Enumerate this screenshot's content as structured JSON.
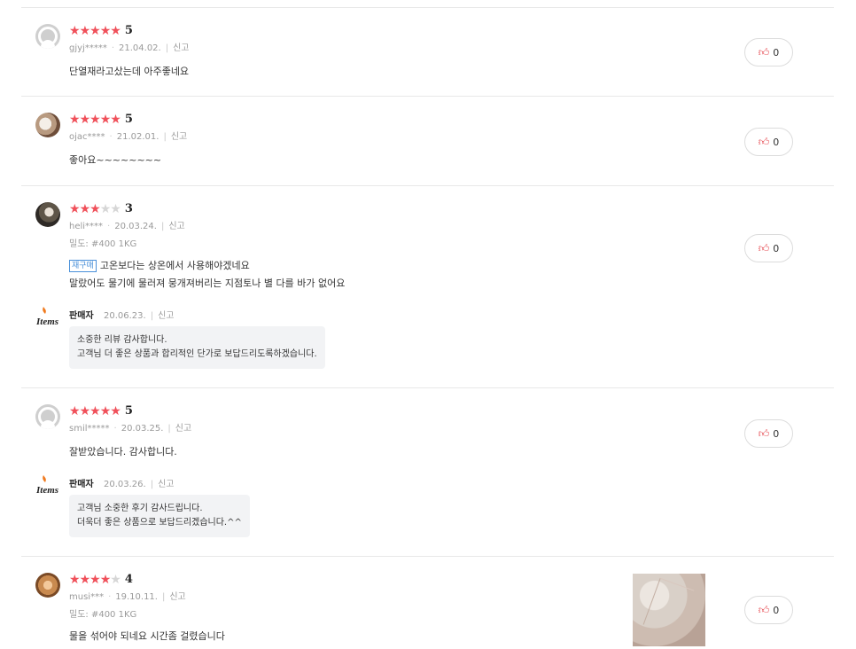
{
  "colors": {
    "star": "#f0505a",
    "star_off": "#d6d6d6",
    "tag": "#4a90d9",
    "like_icon": "#e6484f"
  },
  "report_label": "신고",
  "seller_label": "판매자",
  "reviews": [
    {
      "rating": 5,
      "score": "5",
      "user": "gjyj*****",
      "date": "21.04.02.",
      "option": "",
      "tag": "",
      "lines": [
        "단열재라고샀는데 아주좋네요"
      ],
      "likes": "0",
      "avatar": "default-user-icon"
    },
    {
      "rating": 5,
      "score": "5",
      "user": "ojac****",
      "date": "21.02.01.",
      "option": "",
      "tag": "",
      "lines": [
        "좋아요~~~~~~~~"
      ],
      "likes": "0",
      "avatar": "user-photo"
    },
    {
      "rating": 3,
      "score": "3",
      "user": "heli****",
      "date": "20.03.24.",
      "option": "밀도: #400 1KG",
      "tag": "재구매",
      "lines": [
        "고온보다는 상온에서 사용해야겠네요",
        "말랐어도 물기에 물러져 뭉개져버리는 지점토나 별 다를 바가 없어요"
      ],
      "likes": "0",
      "avatar": "user-photo",
      "reply": {
        "date": "20.06.23.",
        "lines": [
          "소중한 리뷰 감사합니다.",
          "고객님 더 좋은 상품과 합리적인 단가로 보답드리도록하겠습니다."
        ]
      }
    },
    {
      "rating": 5,
      "score": "5",
      "user": "smil*****",
      "date": "20.03.25.",
      "option": "",
      "tag": "",
      "lines": [
        "잘받았습니다. 감사합니다."
      ],
      "likes": "0",
      "avatar": "default-user-icon",
      "reply": {
        "date": "20.03.26.",
        "lines": [
          "고객님 소중한 후기 감사드립니다.",
          "더욱더 좋은 상품으로 보답드리겠습니다.^^"
        ]
      }
    },
    {
      "rating": 4,
      "score": "4",
      "user": "musi***",
      "date": "19.10.11.",
      "option": "밀도: #400 1KG",
      "tag": "",
      "lines": [
        "물을 섞어야 되네요 시간좀 걸렸습니다"
      ],
      "likes": "0",
      "avatar": "user-photo",
      "has_photo": true
    }
  ]
}
